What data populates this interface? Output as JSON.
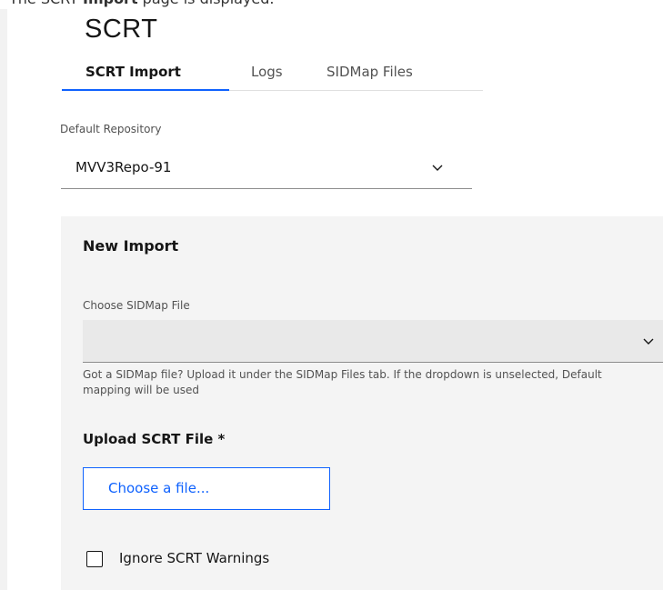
{
  "caption": {
    "prefix": "The SCRT ",
    "bold": "Import",
    "suffix": " page is displayed."
  },
  "page": {
    "title": "SCRT"
  },
  "tabs": [
    {
      "label": "SCRT Import",
      "active": true
    },
    {
      "label": "Logs",
      "active": false
    },
    {
      "label": "SIDMap Files",
      "active": false
    }
  ],
  "default_repository": {
    "label": "Default Repository",
    "selected_value": "MVV3Repo-91"
  },
  "new_import": {
    "title": "New Import",
    "sidmap": {
      "label": "Choose SIDMap File",
      "selected_value": "",
      "helper_text": "Got a SIDMap file? Upload it under the SIDMap Files tab. If the dropdown is unselected, Default mapping will be used"
    },
    "upload": {
      "label": "Upload SCRT File *",
      "button_label": "Choose a file..."
    },
    "ignore_warnings": {
      "label": "Ignore SCRT Warnings",
      "checked": false
    }
  },
  "colors": {
    "accent": "#0f62fe",
    "panel_background": "#f4f4f4",
    "field_background": "#e9e9e9"
  },
  "icons": {
    "dropdown": "chevron-down-icon"
  }
}
